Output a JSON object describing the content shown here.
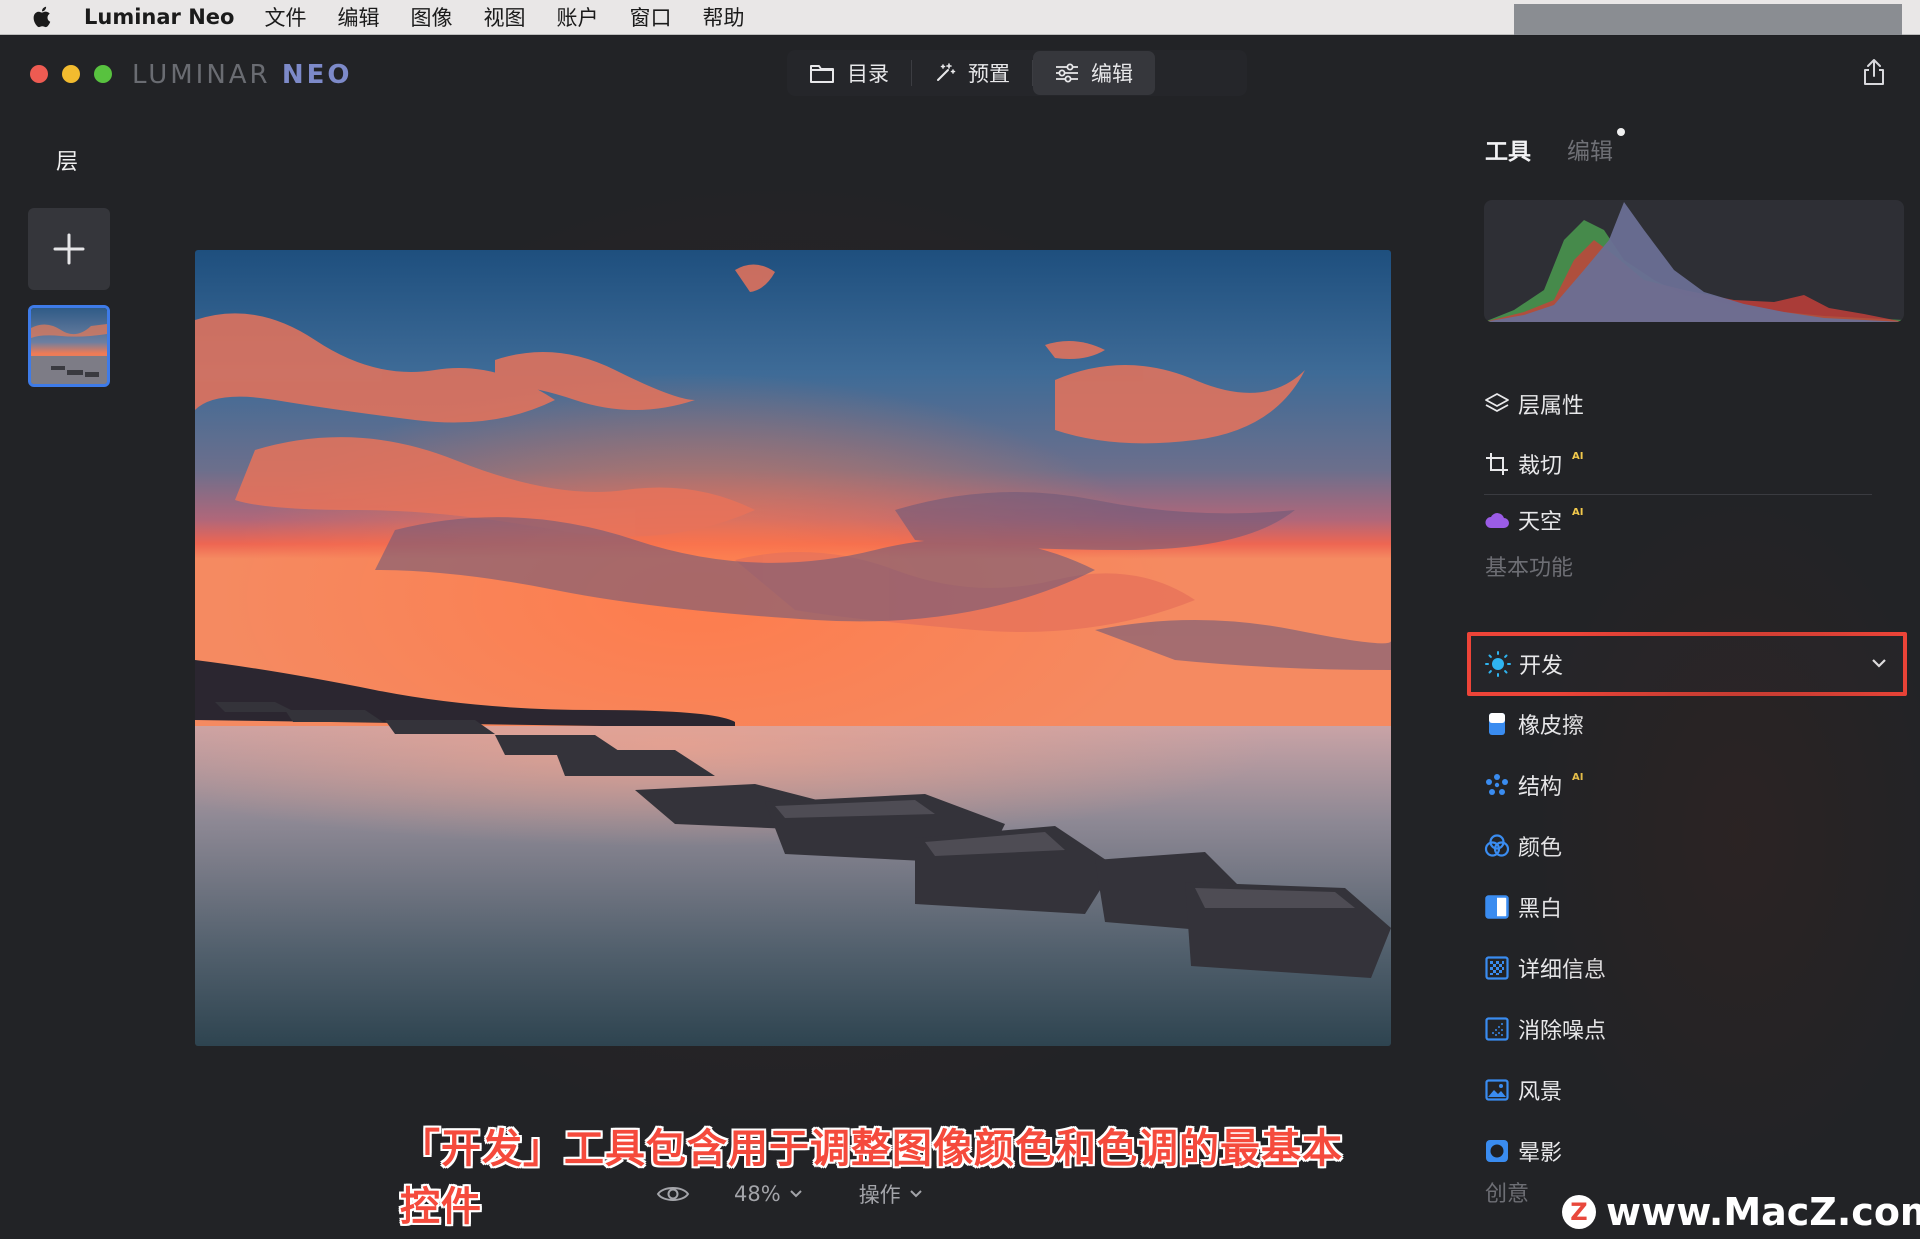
{
  "menubar": {
    "app_name": "Luminar Neo",
    "items": [
      "文件",
      "编辑",
      "图像",
      "视图",
      "账户",
      "窗口",
      "帮助"
    ]
  },
  "window": {
    "brand_left": "LUMINAR",
    "brand_right": "NEO",
    "nav_tabs": [
      {
        "label": "目录",
        "icon": "folder-icon",
        "active": false
      },
      {
        "label": "预置",
        "icon": "magic-wand-icon",
        "active": false
      },
      {
        "label": "编辑",
        "icon": "sliders-icon",
        "active": true
      }
    ]
  },
  "layers": {
    "title": "层"
  },
  "caption": "「开发」工具包含用于调整图像颜色和色调的最基本控件",
  "bottombar": {
    "zoom": "48%",
    "actions": "操作"
  },
  "panel": {
    "tabs": {
      "tools": "工具",
      "edits": "编辑"
    },
    "top_tools": [
      {
        "label": "层属性",
        "ai": "",
        "icon": "layers-icon"
      },
      {
        "label": "裁切",
        "ai": "AI",
        "icon": "crop-icon"
      },
      {
        "label": "天空",
        "ai": "AI",
        "icon": "cloud-icon"
      }
    ],
    "section_essentials": "基本功能",
    "develop": {
      "label": "开发",
      "icon": "sun-icon"
    },
    "essentials": [
      {
        "label": "橡皮擦",
        "ai": "",
        "icon": "eraser-icon"
      },
      {
        "label": "结构",
        "ai": "AI",
        "icon": "structure-icon"
      },
      {
        "label": "颜色",
        "ai": "",
        "icon": "color-icon"
      },
      {
        "label": "黑白",
        "ai": "",
        "icon": "bw-icon"
      },
      {
        "label": "详细信息",
        "ai": "",
        "icon": "details-icon"
      },
      {
        "label": "消除噪点",
        "ai": "",
        "icon": "denoise-icon"
      },
      {
        "label": "风景",
        "ai": "",
        "icon": "landscape-icon"
      },
      {
        "label": "晕影",
        "ai": "",
        "icon": "vignette-icon"
      }
    ],
    "section_creative": "创意"
  },
  "watermark": {
    "logo": "Z",
    "text": "www.MacZ.com"
  },
  "colors": {
    "accent_blue": "#3e7be8",
    "highlight_red": "#ee4438",
    "ai_badge": "#f2c94c"
  }
}
